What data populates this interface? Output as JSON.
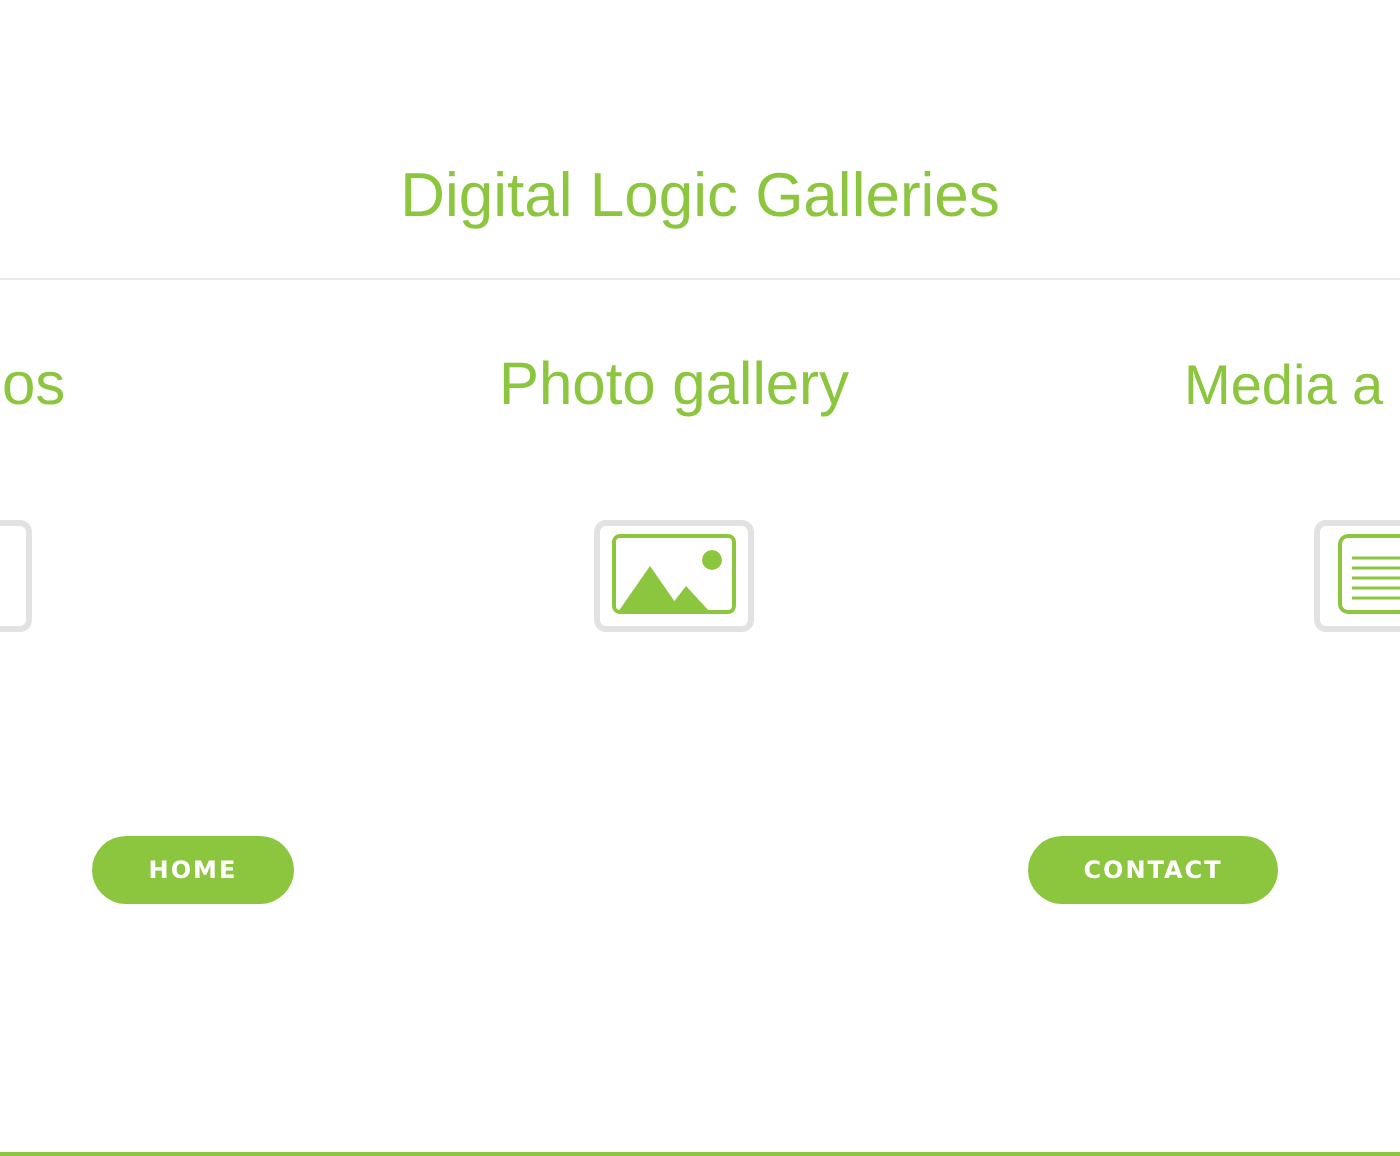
{
  "title": "Digital Logic Galleries",
  "galleries": [
    {
      "title": "os",
      "kind": "frame"
    },
    {
      "title": "Photo gallery",
      "kind": "image"
    },
    {
      "title": "Media a",
      "kind": "text"
    }
  ],
  "buttons": [
    "HOME",
    "CONTACT"
  ]
}
